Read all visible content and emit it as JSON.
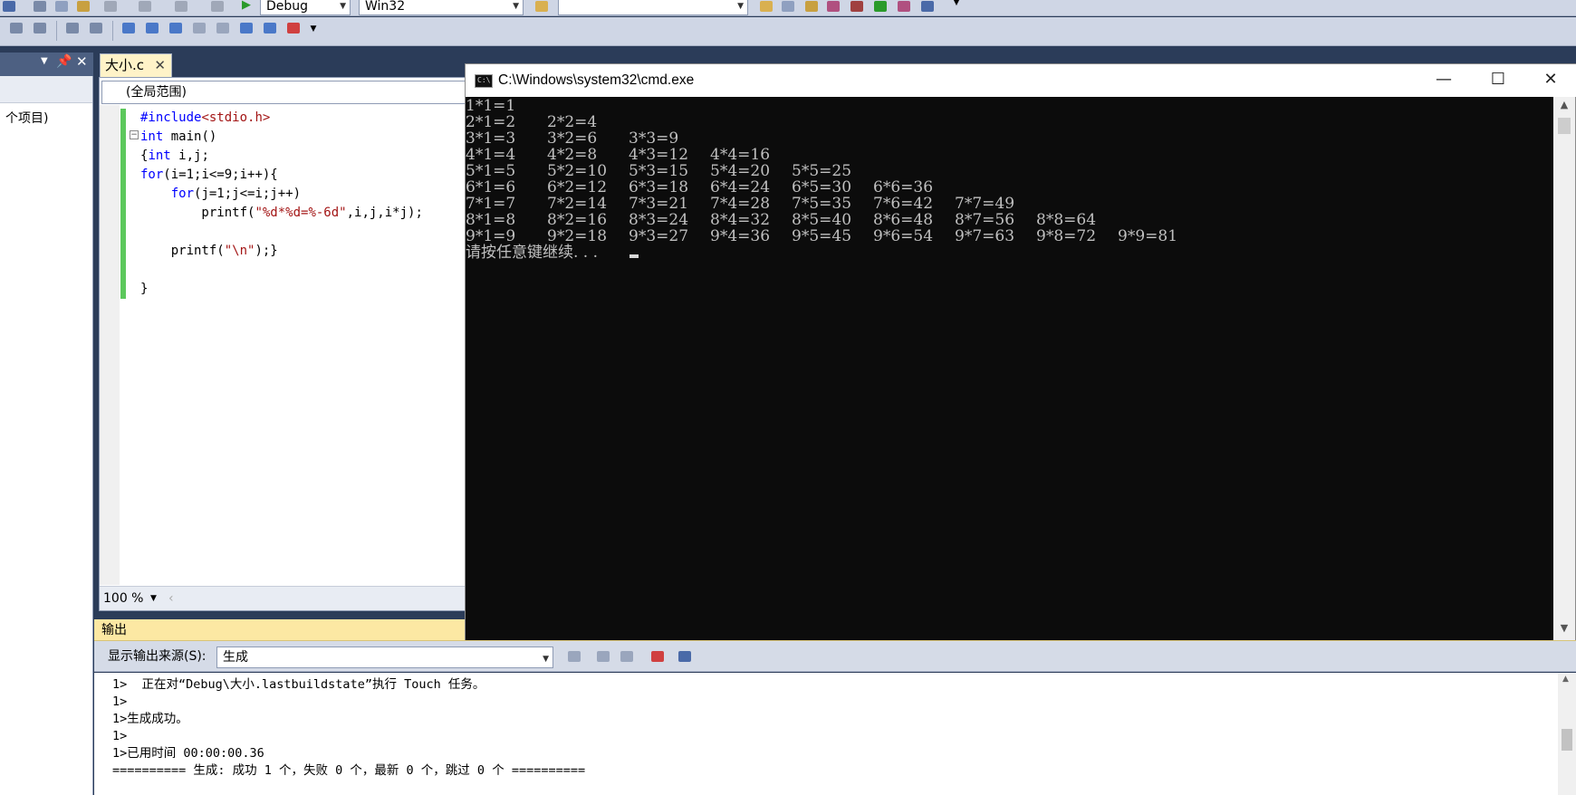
{
  "toolbar": {
    "config_combo": "Debug",
    "platform_combo": "Win32",
    "find_combo": ""
  },
  "solution": {
    "label": "个项目)"
  },
  "editor": {
    "tab_label": "大小.c",
    "scope": "(全局范围)",
    "zoom": "100 %",
    "code_lines": [
      "#include<stdio.h>",
      "int main()",
      "{int i,j;",
      "for(i=1;i<=9;i++){",
      "    for(j=1;j<=i;j++)",
      "        printf(\"%d*%d=%-6d\",i,j,i*j);",
      "",
      "    printf(\"\\n\");}",
      "",
      "}"
    ]
  },
  "output": {
    "title": "输出",
    "source_label": "显示输出来源(S):",
    "source_value": "生成",
    "lines": [
      "1>  正在对“Debug\\大小.lastbuildstate”执行 Touch 任务。",
      "1>",
      "1>生成成功。",
      "1>",
      "1>已用时间 00:00:00.36",
      "========== 生成: 成功 1 个，失败 0 个，最新 0 个，跳过 0 个 =========="
    ]
  },
  "cmd": {
    "title": "C:\\Windows\\system32\\cmd.exe",
    "icon_text": "C:\\",
    "rows": [
      [
        "1*1=1"
      ],
      [
        "2*1=2",
        "2*2=4"
      ],
      [
        "3*1=3",
        "3*2=6",
        "3*3=9"
      ],
      [
        "4*1=4",
        "4*2=8",
        "4*3=12",
        "4*4=16"
      ],
      [
        "5*1=5",
        "5*2=10",
        "5*3=15",
        "5*4=20",
        "5*5=25"
      ],
      [
        "6*1=6",
        "6*2=12",
        "6*3=18",
        "6*4=24",
        "6*5=30",
        "6*6=36"
      ],
      [
        "7*1=7",
        "7*2=14",
        "7*3=21",
        "7*4=28",
        "7*5=35",
        "7*6=42",
        "7*7=49"
      ],
      [
        "8*1=8",
        "8*2=16",
        "8*3=24",
        "8*4=32",
        "8*5=40",
        "8*6=48",
        "8*7=56",
        "8*8=64"
      ],
      [
        "9*1=9",
        "9*2=18",
        "9*3=27",
        "9*4=36",
        "9*5=45",
        "9*6=54",
        "9*7=63",
        "9*8=72",
        "9*9=81"
      ]
    ],
    "prompt": "请按任意键继续. . ."
  },
  "icons": [
    "minimize-icon",
    "maximize-icon",
    "close-icon",
    "console-icon",
    "play-icon",
    "dropdown-arrow-icon"
  ]
}
